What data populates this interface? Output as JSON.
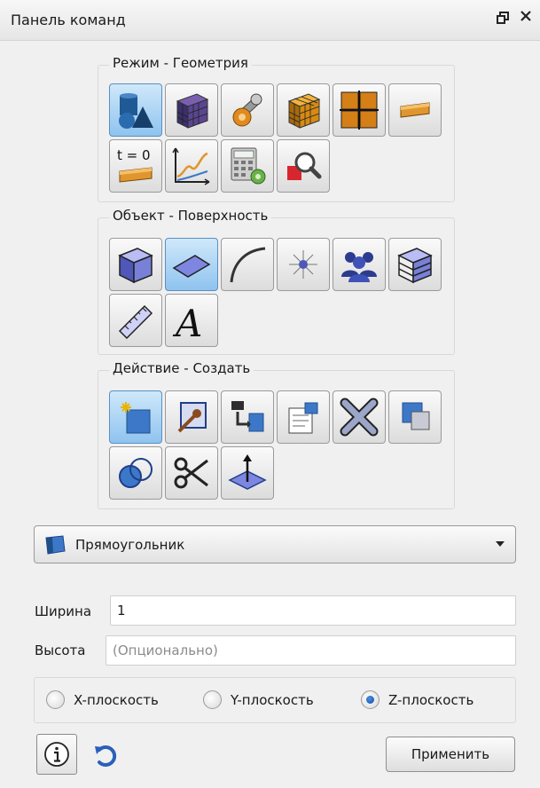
{
  "panel": {
    "title": "Панель команд",
    "float_icon": "restore-icon",
    "close_icon": "close-icon"
  },
  "mode_group": {
    "legend": "Режим - Геометрия",
    "buttons": [
      {
        "name": "geometry-mode-icon",
        "active": true
      },
      {
        "name": "mesh-mode-icon",
        "active": false
      },
      {
        "name": "settings-wrench-icon",
        "active": false
      },
      {
        "name": "volume-mesh-icon",
        "active": false
      },
      {
        "name": "grid-blocks-icon",
        "active": false
      },
      {
        "name": "boundary-conditions-icon",
        "active": false
      },
      {
        "name": "initial-conditions-t0-icon",
        "label": "t = 0",
        "active": false
      },
      {
        "name": "graph-plot-icon",
        "active": false
      },
      {
        "name": "calculator-settings-icon",
        "active": false
      },
      {
        "name": "inspect-zoom-icon",
        "active": false
      }
    ]
  },
  "object_group": {
    "legend": "Объект - Поверхность",
    "buttons": [
      {
        "name": "volume-cube-icon",
        "active": false
      },
      {
        "name": "surface-plane-icon",
        "active": true
      },
      {
        "name": "curve-icon",
        "active": false
      },
      {
        "name": "vertex-point-icon",
        "active": false
      },
      {
        "name": "group-people-icon",
        "active": false
      },
      {
        "name": "layers-body-icon",
        "active": false
      },
      {
        "name": "measure-ruler-icon",
        "active": false
      },
      {
        "name": "text-annotation-icon",
        "label": "A",
        "active": false
      }
    ]
  },
  "action_group": {
    "legend": "Действие - Создать",
    "buttons": [
      {
        "name": "create-new-icon",
        "active": true
      },
      {
        "name": "edit-object-icon",
        "active": false
      },
      {
        "name": "transform-copy-icon",
        "active": false
      },
      {
        "name": "properties-icon",
        "active": false
      },
      {
        "name": "delete-x-icon",
        "active": false
      },
      {
        "name": "overlay-duplicate-icon",
        "active": false
      },
      {
        "name": "boolean-intersect-icon",
        "active": false
      },
      {
        "name": "split-scissors-icon",
        "active": false
      },
      {
        "name": "sweep-arrow-icon",
        "active": false
      }
    ]
  },
  "shape_select": {
    "value": "Прямоугольник",
    "icon": "rectangle-surface-icon"
  },
  "fields": {
    "width_label": "Ширина",
    "width_value": "1",
    "height_label": "Высота",
    "height_placeholder": "(Опционально)"
  },
  "plane": {
    "options": [
      "X-плоскость",
      "Y-плоскость",
      "Z-плоскость"
    ],
    "selected": "Z-плоскость"
  },
  "footer": {
    "info_icon": "info-icon",
    "reset_icon": "reset-undo-icon",
    "apply_label": "Применить"
  },
  "colors": {
    "accent_blue": "#3d78c8",
    "active_button": "#a6d0f3",
    "orange": "#e08a1f"
  }
}
